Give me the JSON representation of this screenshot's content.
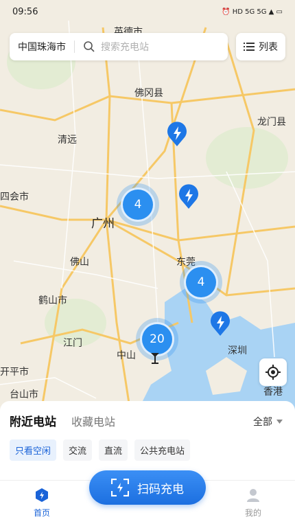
{
  "status_bar": {
    "time": "09:56",
    "indicators": "⏰ HD 5G 5G ▲ ▭"
  },
  "search": {
    "city": "中国珠海市",
    "placeholder": "搜索充电站"
  },
  "list_button": {
    "label": "列表"
  },
  "map": {
    "places": [
      {
        "name": "英德市"
      },
      {
        "name": "佛冈县"
      },
      {
        "name": "龙门县"
      },
      {
        "name": "清远"
      },
      {
        "name": "四会市"
      },
      {
        "name": "广州"
      },
      {
        "name": "佛山"
      },
      {
        "name": "东莞"
      },
      {
        "name": "鹤山市"
      },
      {
        "name": "江门"
      },
      {
        "name": "中山"
      },
      {
        "name": "深圳"
      },
      {
        "name": "开平市"
      },
      {
        "name": "台山市"
      },
      {
        "name": "香港"
      }
    ],
    "clusters": [
      {
        "count": "4"
      },
      {
        "count": "4"
      },
      {
        "count": "20"
      }
    ],
    "accent": "#2b8ff0"
  },
  "panel": {
    "tab_nearby": "附近电站",
    "tab_favorites": "收藏电站",
    "filter_all": "全部",
    "chips": [
      "只看空闲",
      "交流",
      "直流",
      "公共充电站"
    ]
  },
  "scan_button": {
    "label": "扫码充电"
  },
  "bottom_nav": {
    "home": "首页",
    "mine": "我的"
  }
}
